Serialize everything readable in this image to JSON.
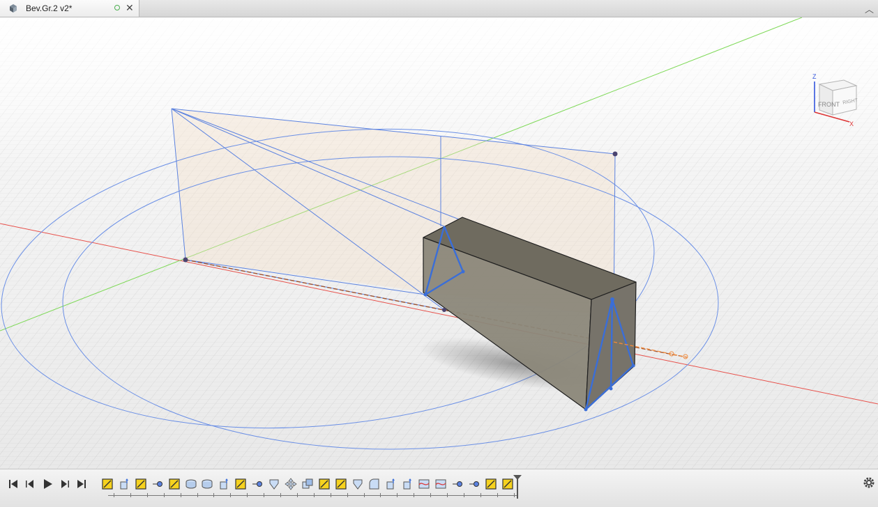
{
  "tab": {
    "title": "Bev.Gr.2 v2*",
    "icon": "box-icon",
    "close_label": "✕"
  },
  "collapse_label": "︿",
  "viewcube": {
    "front_label": "FRONT",
    "right_label": "RIGHT",
    "z_label": "Z",
    "x_label": "X"
  },
  "timeline": {
    "playback": [
      "skip-to-start-icon",
      "step-back-icon",
      "play-icon",
      "step-forward-icon",
      "skip-to-end-icon"
    ],
    "features": [
      "sketch",
      "extrude",
      "sketch",
      "point",
      "sketch",
      "revolve",
      "revolve",
      "extrude",
      "sketch",
      "point",
      "shell",
      "move",
      "combine",
      "sketch",
      "sketch",
      "shell",
      "fillet",
      "extrude",
      "extrude",
      "loft",
      "loft",
      "point",
      "point",
      "sketch",
      "sketch"
    ]
  },
  "colors": {
    "axis_x": "#e8504a",
    "axis_y": "#7ed957",
    "sketch": "#5b82e0",
    "body": "#878273",
    "sketch_fill": "#f3dcc4"
  }
}
